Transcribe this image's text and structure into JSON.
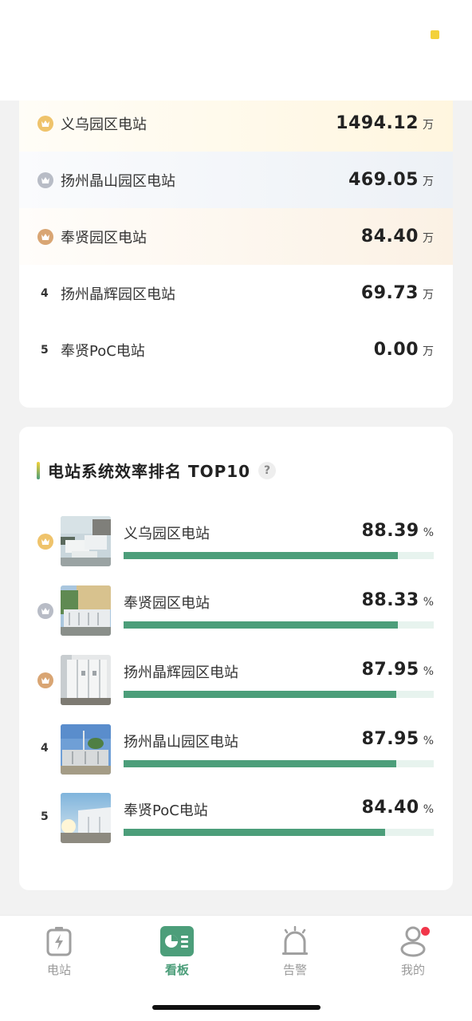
{
  "revenue_ranking": {
    "unit": "万",
    "items": [
      {
        "rank": "1",
        "badge": "crown-gold",
        "name": "义乌园区电站",
        "value": "1494.12"
      },
      {
        "rank": "2",
        "badge": "crown-silver",
        "name": "扬州晶山园区电站",
        "value": "469.05"
      },
      {
        "rank": "3",
        "badge": "crown-bronze",
        "name": "奉贤园区电站",
        "value": "84.40"
      },
      {
        "rank": "4",
        "badge": "",
        "name": "扬州晶辉园区电站",
        "value": "69.73"
      },
      {
        "rank": "5",
        "badge": "",
        "name": "奉贤PoC电站",
        "value": "0.00"
      }
    ]
  },
  "efficiency_ranking": {
    "title": "电站系统效率排名 TOP10",
    "help_icon": "?",
    "unit": "%",
    "items": [
      {
        "rank": "1",
        "badge": "crown-gold",
        "name": "义乌园区电站",
        "value": "88.39",
        "progress": 0.8839
      },
      {
        "rank": "2",
        "badge": "crown-silver",
        "name": "奉贤园区电站",
        "value": "88.33",
        "progress": 0.8833
      },
      {
        "rank": "3",
        "badge": "crown-bronze",
        "name": "扬州晶辉园区电站",
        "value": "87.95",
        "progress": 0.8795
      },
      {
        "rank": "4",
        "badge": "",
        "name": "扬州晶山园区电站",
        "value": "87.95",
        "progress": 0.8795
      },
      {
        "rank": "5",
        "badge": "",
        "name": "奉贤PoC电站",
        "value": "84.40",
        "progress": 0.844
      }
    ]
  },
  "tabbar": {
    "tabs": [
      {
        "label": "电站",
        "icon": "battery-bolt-icon",
        "active": false
      },
      {
        "label": "看板",
        "icon": "dashboard-pie-icon",
        "active": true
      },
      {
        "label": "告警",
        "icon": "alarm-bell-icon",
        "active": false
      },
      {
        "label": "我的",
        "icon": "user-profile-icon",
        "active": false,
        "has_dot": true
      }
    ]
  },
  "colors": {
    "accent": "#4c9e7a",
    "gold": "#efc36b",
    "silver": "#b8bcc6",
    "bronze": "#d9a573",
    "notify_dot": "#f1364a",
    "header_dot": "#f3d13a"
  }
}
